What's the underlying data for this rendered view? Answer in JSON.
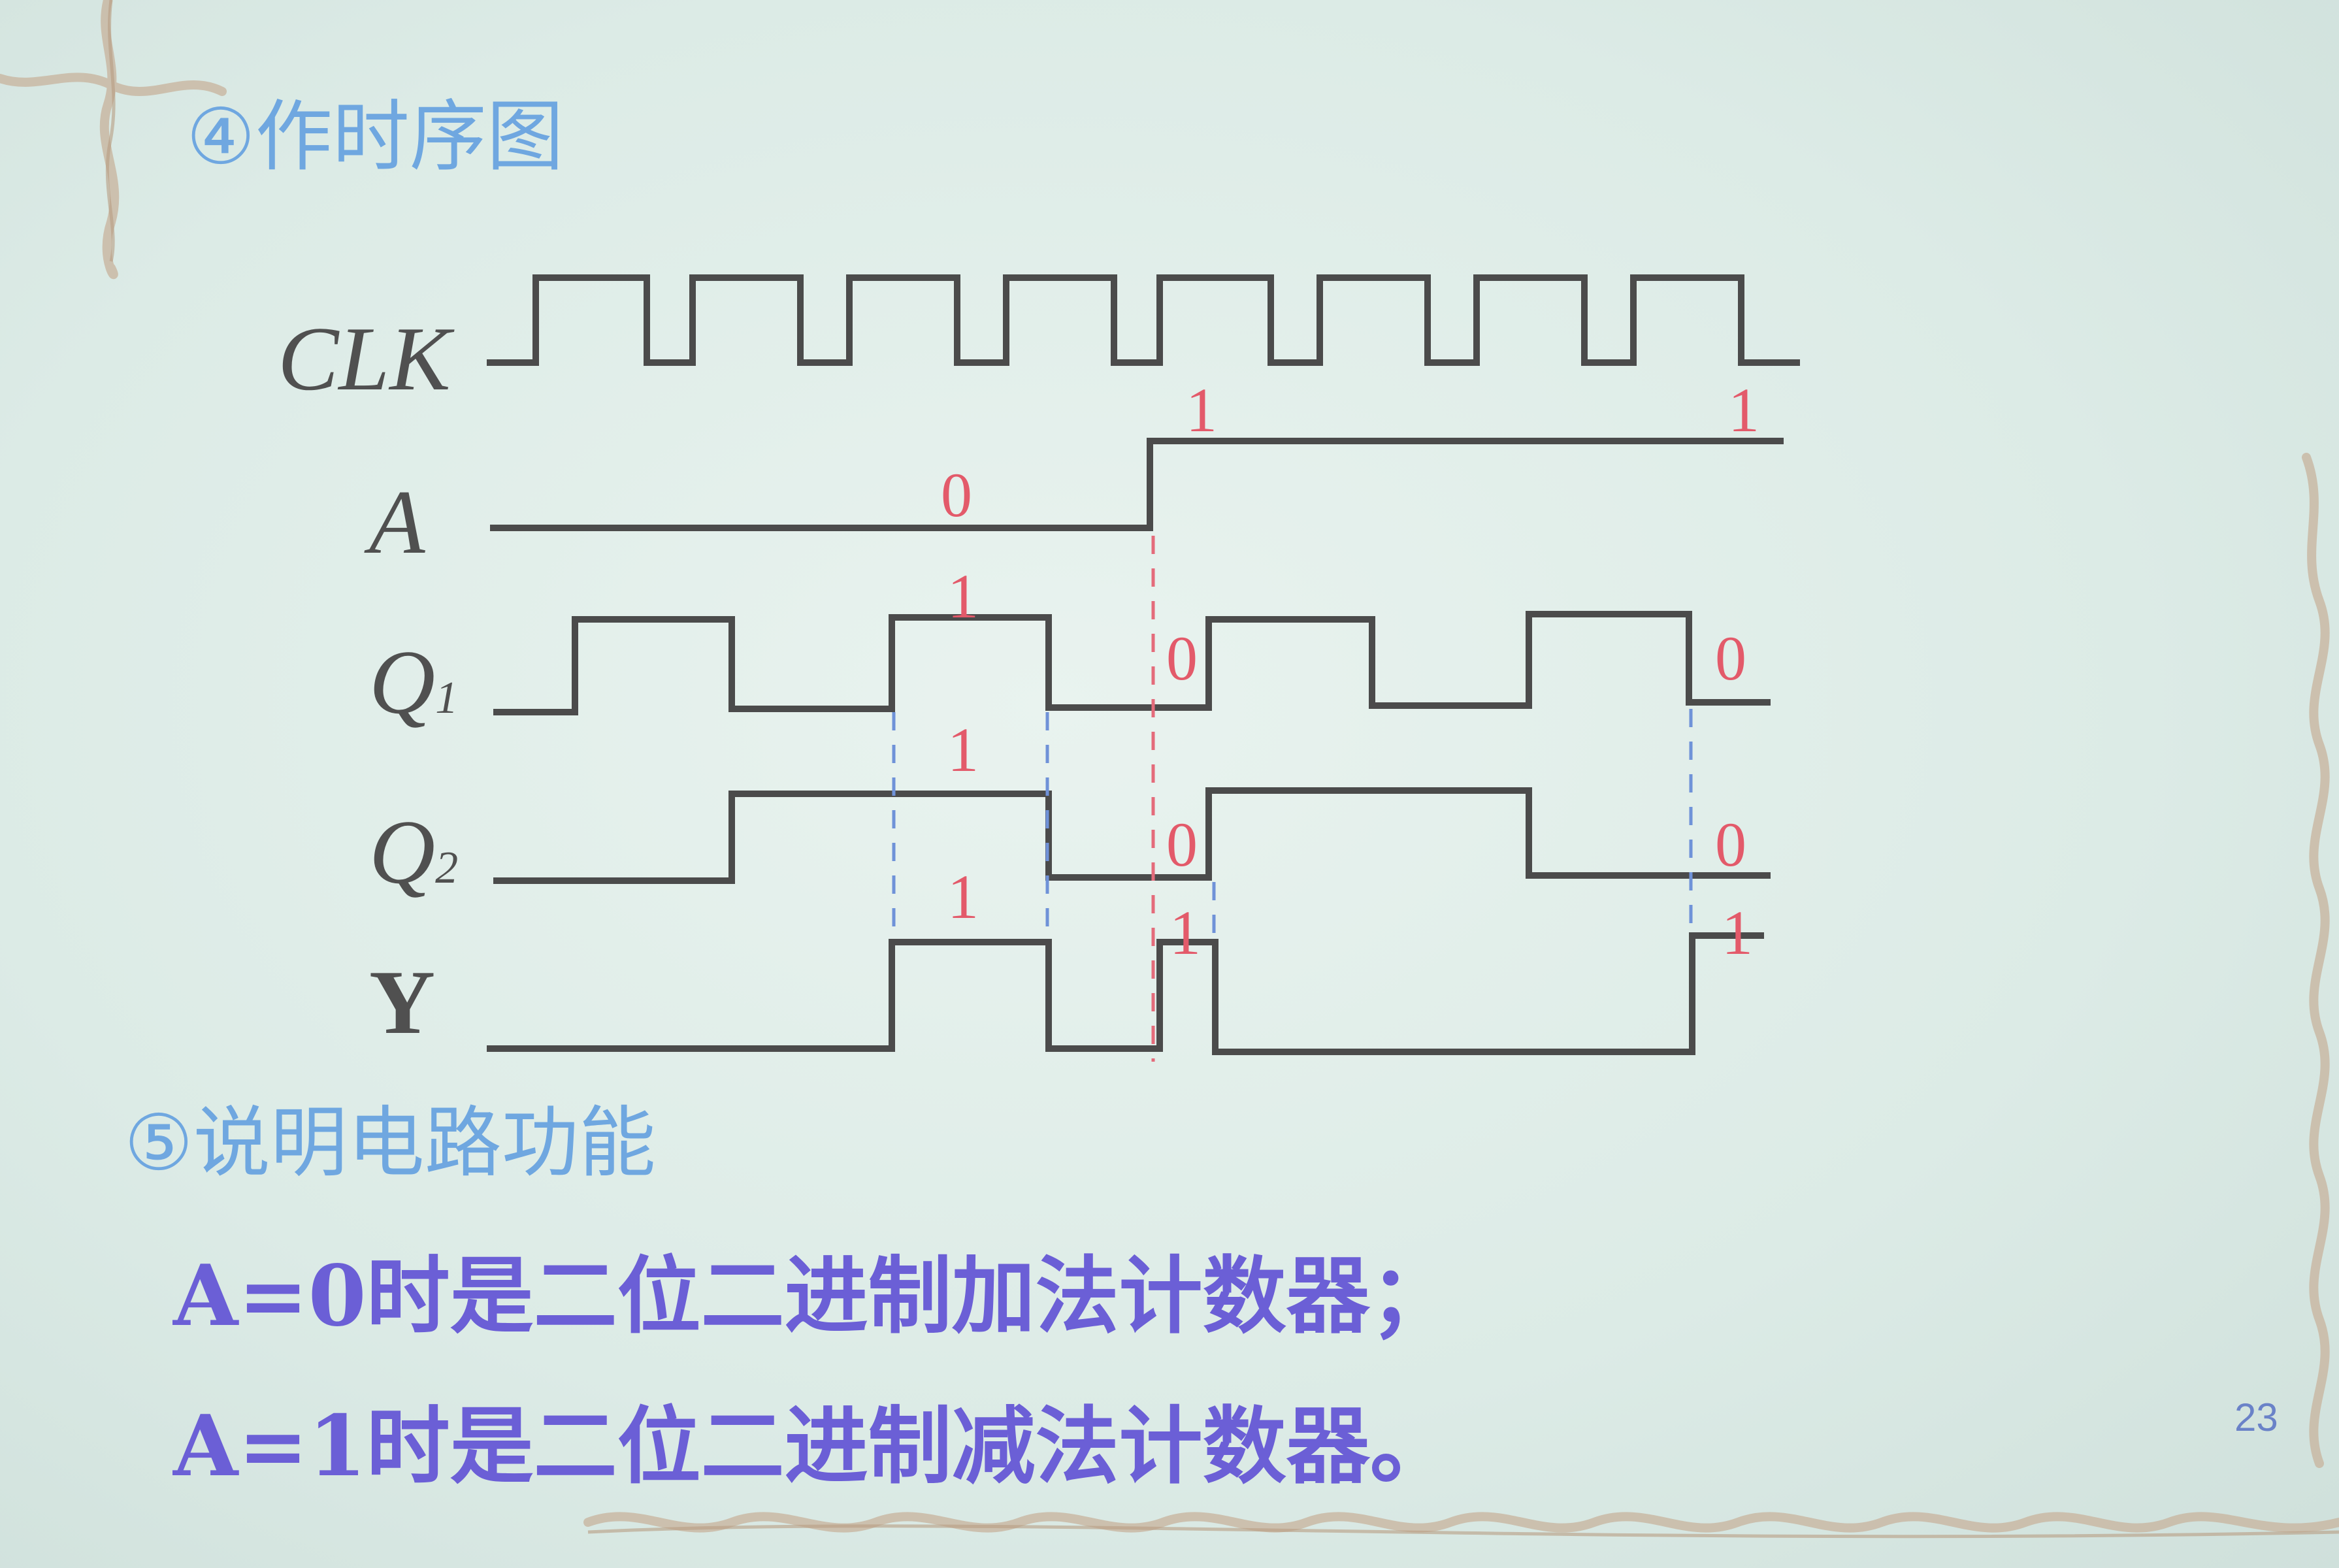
{
  "heading_timing": "④作时序图",
  "heading_function": "⑤说明电路功能",
  "signals": {
    "clk": "CLK",
    "a": "A",
    "q1_main": "Q",
    "q1_sub": "1",
    "q2_main": "Q",
    "q2_sub": "2",
    "y": "Y"
  },
  "annotations": {
    "a_before": "0",
    "a_after_1": "1",
    "a_after_2": "1",
    "q1_mid": "1",
    "q1_switch": "0",
    "q1_end": "0",
    "q2_mid": "1",
    "q2_switch": "0",
    "q2_end": "0",
    "y_mid": "1",
    "y_switch": "1",
    "y_end": "1"
  },
  "function_lines": [
    "A=0时是二位二进制加法计数器；",
    "A=1时是二位二进制减法计数器。"
  ],
  "page_number": "23",
  "colors": {
    "heading": "#6fa7e0",
    "body_text": "#6b5fd6",
    "waveform": "#4b4b4b",
    "annotation": "#e35a6a",
    "guide_blue": "#6f92d8"
  }
}
